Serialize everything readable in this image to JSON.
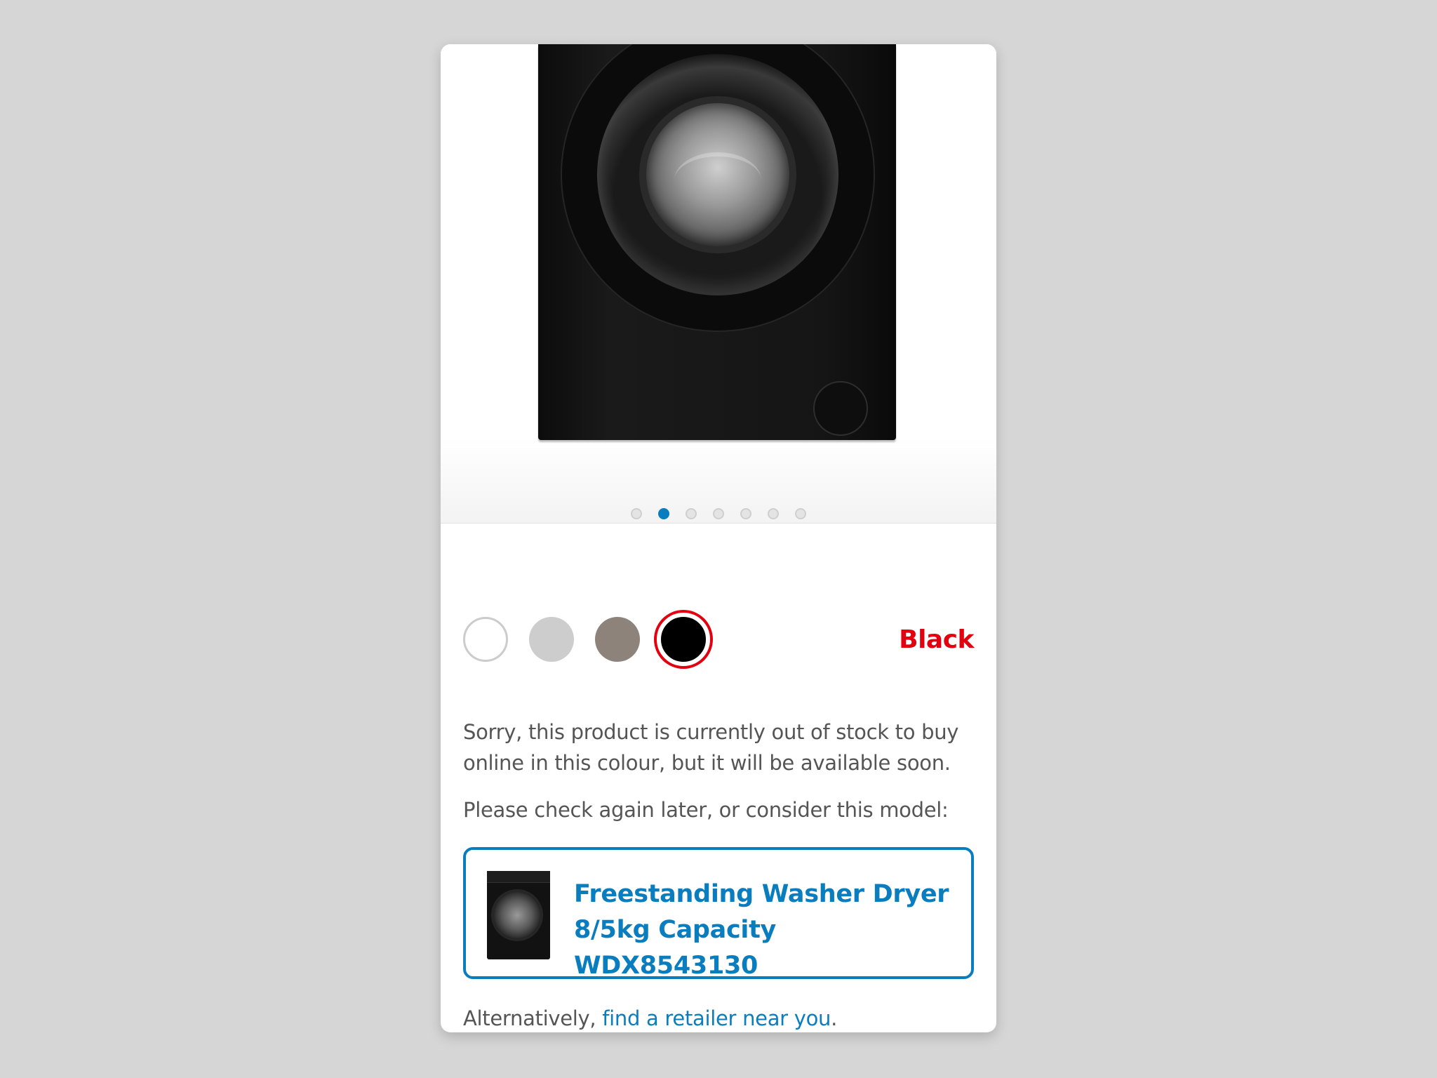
{
  "gallery": {
    "image_alt": "Black washing machine",
    "dot_count": 7,
    "active_dot_index": 1
  },
  "colours": {
    "swatches": [
      {
        "name": "white",
        "hex": "#ffffff"
      },
      {
        "name": "silver",
        "hex": "#cdcdcd"
      },
      {
        "name": "graphite",
        "hex": "#8d837b"
      },
      {
        "name": "black",
        "hex": "#000000"
      }
    ],
    "selected_label": "Black",
    "selected_color": "#e3000f"
  },
  "stock": {
    "message": "Sorry, this product is currently out of stock to buy online in this colour, but it will be available soon.",
    "suggestion": "Please check again later, or consider this model:"
  },
  "alternative": {
    "title_line1": "Freestanding Washer Dryer",
    "title_line2": "8/5kg Capacity WDX8543130",
    "accent_color": "#0a7dbf"
  },
  "retailer": {
    "prefix": "Alternatively, ",
    "link_label": "find a retailer near you",
    "suffix": "."
  }
}
